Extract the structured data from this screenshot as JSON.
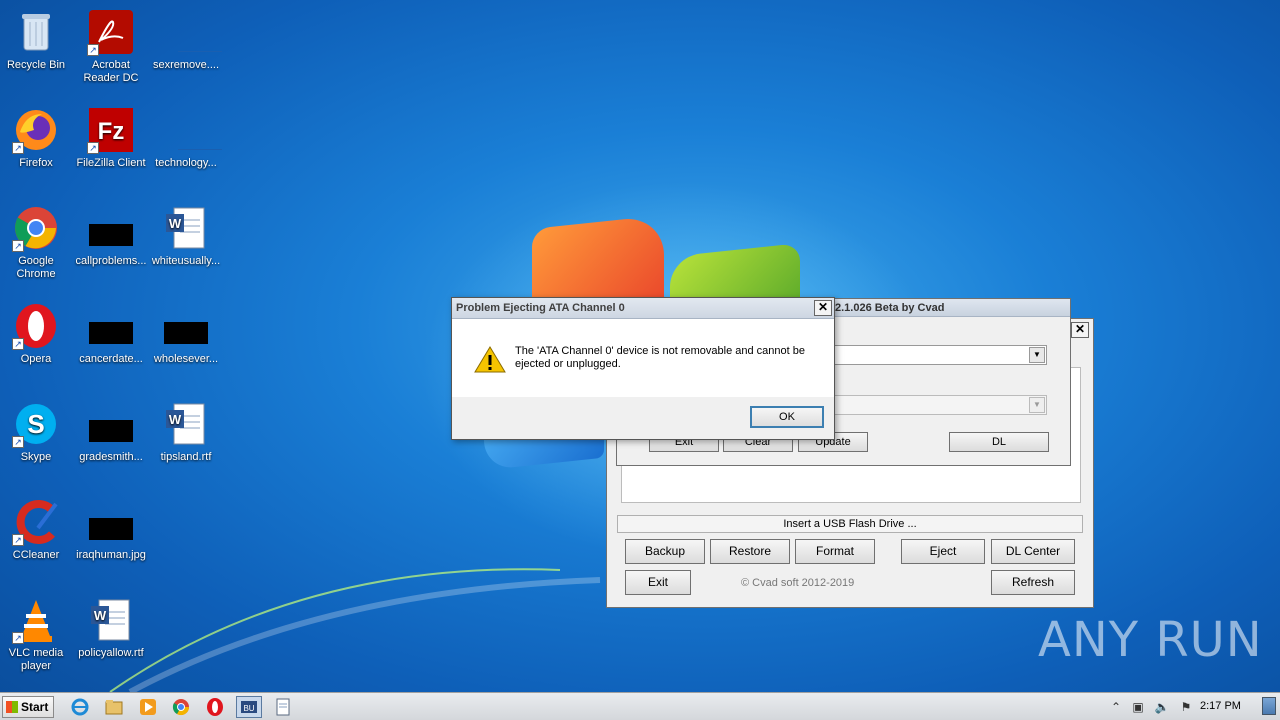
{
  "desktop_icons": [
    {
      "label": "Recycle Bin"
    },
    {
      "label": "Acrobat Reader DC"
    },
    {
      "label": "sexremove...."
    },
    {
      "label": "Firefox"
    },
    {
      "label": "FileZilla Client"
    },
    {
      "label": "technology..."
    },
    {
      "label": "Google Chrome"
    },
    {
      "label": "callproblems..."
    },
    {
      "label": "whiteusually..."
    },
    {
      "label": "Opera"
    },
    {
      "label": "cancerdate..."
    },
    {
      "label": "wholesever..."
    },
    {
      "label": "Skype"
    },
    {
      "label": "gradesmith..."
    },
    {
      "label": "tipsland.rtf"
    },
    {
      "label": "CCleaner"
    },
    {
      "label": "iraqhuman.jpg"
    },
    {
      "label": "VLC media player"
    },
    {
      "label": "policyallow.rtf"
    }
  ],
  "app_window": {
    "title_partial": "2.1.026 Beta by Cvad",
    "status_text": "Insert a USB Flash Drive ...",
    "buttons": {
      "backup": "Backup",
      "restore": "Restore",
      "format": "Format",
      "eject": "Eject",
      "dl_center": "DL Center",
      "exit": "Exit",
      "refresh": "Refresh",
      "exit2": "Exit",
      "clear": "Clear",
      "update": "Update",
      "dl": "DL"
    },
    "copyright": "© Cvad soft 2012-2019"
  },
  "dialog": {
    "title": "Problem Ejecting ATA Channel 0",
    "message": "The 'ATA Channel 0' device is not removable and cannot be ejected or unplugged.",
    "ok_label": "OK"
  },
  "taskbar": {
    "start_label": "Start",
    "clock": "2:17 PM"
  },
  "watermark": "ANY RUN",
  "colors": {
    "desktop_blue": "#1a7fd6",
    "dialog_button_border": "#3c7fb1",
    "warning_yellow": "#f5c400"
  }
}
